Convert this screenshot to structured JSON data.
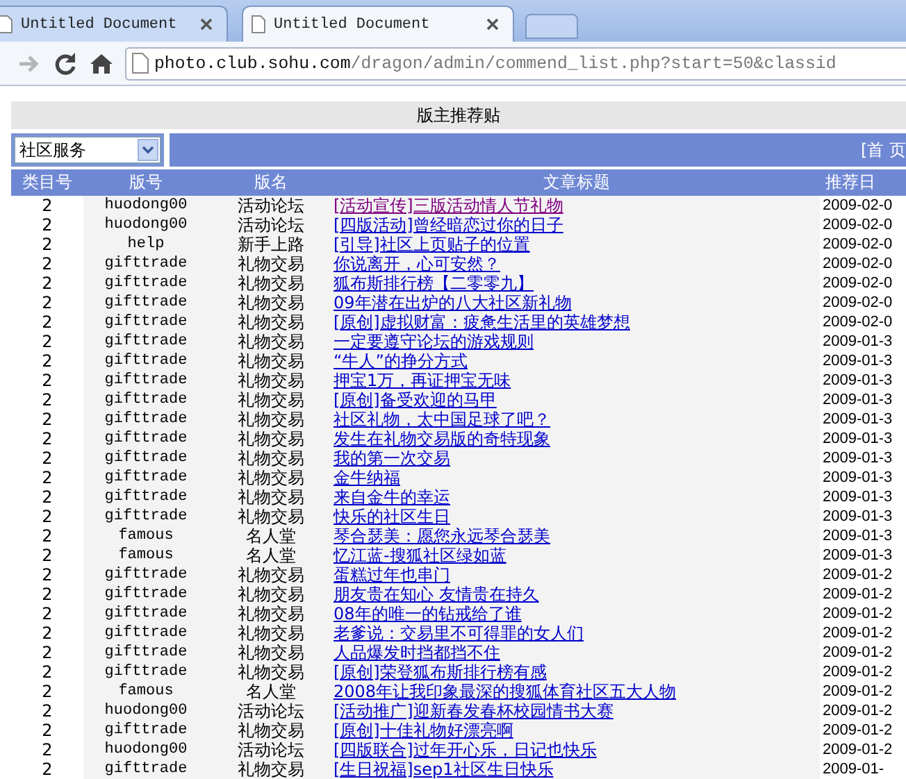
{
  "browser": {
    "tabs": [
      {
        "title": "Untitled Document",
        "selected": false
      },
      {
        "title": "Untitled Document",
        "selected": true
      }
    ],
    "url_host": "photo.club.sohu.com",
    "url_path": "/dragon/admin/commend_list.php?start=50&classid"
  },
  "page": {
    "heading": "版主推荐贴",
    "category_select": {
      "value": "社区服务"
    },
    "pager_text": "[首 页",
    "columns": [
      "类目号",
      "版号",
      "版名",
      "文章标题",
      "推荐日"
    ],
    "rows": [
      {
        "class_no": "2",
        "board_id": "huodong00",
        "board_name": "活动论坛",
        "title": "[活动宣传]三版活动情人节礼物",
        "visited": true,
        "date": "2009-02-0"
      },
      {
        "class_no": "2",
        "board_id": "huodong00",
        "board_name": "活动论坛",
        "title": "[四版活动]曾经暗恋过你的日子",
        "visited": false,
        "date": "2009-02-0"
      },
      {
        "class_no": "2",
        "board_id": "help",
        "board_name": "新手上路",
        "title": "[引导]社区上页贴子的位置",
        "visited": false,
        "date": "2009-02-0"
      },
      {
        "class_no": "2",
        "board_id": "gifttrade",
        "board_name": "礼物交易",
        "title": "你说离开，心可安然？",
        "visited": false,
        "date": "2009-02-0"
      },
      {
        "class_no": "2",
        "board_id": "gifttrade",
        "board_name": "礼物交易",
        "title": "狐布斯排行榜【二零零九】",
        "visited": false,
        "date": "2009-02-0"
      },
      {
        "class_no": "2",
        "board_id": "gifttrade",
        "board_name": "礼物交易",
        "title": "09年潜在出炉的八大社区新礼物",
        "visited": false,
        "date": "2009-02-0"
      },
      {
        "class_no": "2",
        "board_id": "gifttrade",
        "board_name": "礼物交易",
        "title": "[原创]虚拟财富：疲惫生活里的英雄梦想",
        "visited": false,
        "date": "2009-02-0"
      },
      {
        "class_no": "2",
        "board_id": "gifttrade",
        "board_name": "礼物交易",
        "title": "一定要遵守论坛的游戏规则",
        "visited": false,
        "date": "2009-01-3"
      },
      {
        "class_no": "2",
        "board_id": "gifttrade",
        "board_name": "礼物交易",
        "title": "“牛人”的挣分方式",
        "visited": false,
        "date": "2009-01-3"
      },
      {
        "class_no": "2",
        "board_id": "gifttrade",
        "board_name": "礼物交易",
        "title": "押宝1万，再证押宝无味",
        "visited": false,
        "date": "2009-01-3"
      },
      {
        "class_no": "2",
        "board_id": "gifttrade",
        "board_name": "礼物交易",
        "title": "[原创]备受欢迎的马甲",
        "visited": false,
        "date": "2009-01-3"
      },
      {
        "class_no": "2",
        "board_id": "gifttrade",
        "board_name": "礼物交易",
        "title": "社区礼物，太中国足球了吧？",
        "visited": false,
        "date": "2009-01-3"
      },
      {
        "class_no": "2",
        "board_id": "gifttrade",
        "board_name": "礼物交易",
        "title": "发生在礼物交易版的奇特现象",
        "visited": false,
        "date": "2009-01-3"
      },
      {
        "class_no": "2",
        "board_id": "gifttrade",
        "board_name": "礼物交易",
        "title": "我的第一次交易",
        "visited": false,
        "date": "2009-01-3"
      },
      {
        "class_no": "2",
        "board_id": "gifttrade",
        "board_name": "礼物交易",
        "title": "金牛纳福",
        "visited": false,
        "date": "2009-01-3"
      },
      {
        "class_no": "2",
        "board_id": "gifttrade",
        "board_name": "礼物交易",
        "title": "来自金牛的幸运",
        "visited": false,
        "date": "2009-01-3"
      },
      {
        "class_no": "2",
        "board_id": "gifttrade",
        "board_name": "礼物交易",
        "title": "快乐的社区生日",
        "visited": false,
        "date": "2009-01-3"
      },
      {
        "class_no": "2",
        "board_id": "famous",
        "board_name": "名人堂",
        "title": "琴合瑟美：愿您永远琴合瑟美",
        "visited": false,
        "date": "2009-01-3"
      },
      {
        "class_no": "2",
        "board_id": "famous",
        "board_name": "名人堂",
        "title": "忆江蓝-搜狐社区绿如蓝",
        "visited": false,
        "date": "2009-01-3"
      },
      {
        "class_no": "2",
        "board_id": "gifttrade",
        "board_name": "礼物交易",
        "title": "蛋糕过年也串门",
        "visited": false,
        "date": "2009-01-2"
      },
      {
        "class_no": "2",
        "board_id": "gifttrade",
        "board_name": "礼物交易",
        "title": "朋友贵在知心 友情贵在持久",
        "visited": false,
        "date": "2009-01-2"
      },
      {
        "class_no": "2",
        "board_id": "gifttrade",
        "board_name": "礼物交易",
        "title": "08年的唯一的钻戒给了谁",
        "visited": false,
        "date": "2009-01-2"
      },
      {
        "class_no": "2",
        "board_id": "gifttrade",
        "board_name": "礼物交易",
        "title": "老爹说：交易里不可得罪的女人们",
        "visited": false,
        "date": "2009-01-2"
      },
      {
        "class_no": "2",
        "board_id": "gifttrade",
        "board_name": "礼物交易",
        "title": "人品爆发时挡都挡不住",
        "visited": false,
        "date": "2009-01-2"
      },
      {
        "class_no": "2",
        "board_id": "gifttrade",
        "board_name": "礼物交易",
        "title": "[原创]荣登狐布斯排行榜有感",
        "visited": false,
        "date": "2009-01-2"
      },
      {
        "class_no": "2",
        "board_id": "famous",
        "board_name": "名人堂",
        "title": "2008年让我印象最深的搜狐体育社区五大人物",
        "visited": false,
        "date": "2009-01-2"
      },
      {
        "class_no": "2",
        "board_id": "huodong00",
        "board_name": "活动论坛",
        "title": "[活动推广]迎新春发春杯校园情书大赛",
        "visited": false,
        "date": "2009-01-2"
      },
      {
        "class_no": "2",
        "board_id": "gifttrade",
        "board_name": "礼物交易",
        "title": "[原创]十佳礼物好漂亮啊",
        "visited": false,
        "date": "2009-01-2"
      },
      {
        "class_no": "2",
        "board_id": "huodong00",
        "board_name": "活动论坛",
        "title": "[四版联合]过年开心乐，日记也快乐",
        "visited": false,
        "date": "2009-01-2"
      },
      {
        "class_no": "2",
        "board_id": "gifttrade",
        "board_name": "礼物交易",
        "title": "[生日祝福]sep1社区生日快乐",
        "visited": false,
        "date": "2009-01-"
      }
    ]
  }
}
